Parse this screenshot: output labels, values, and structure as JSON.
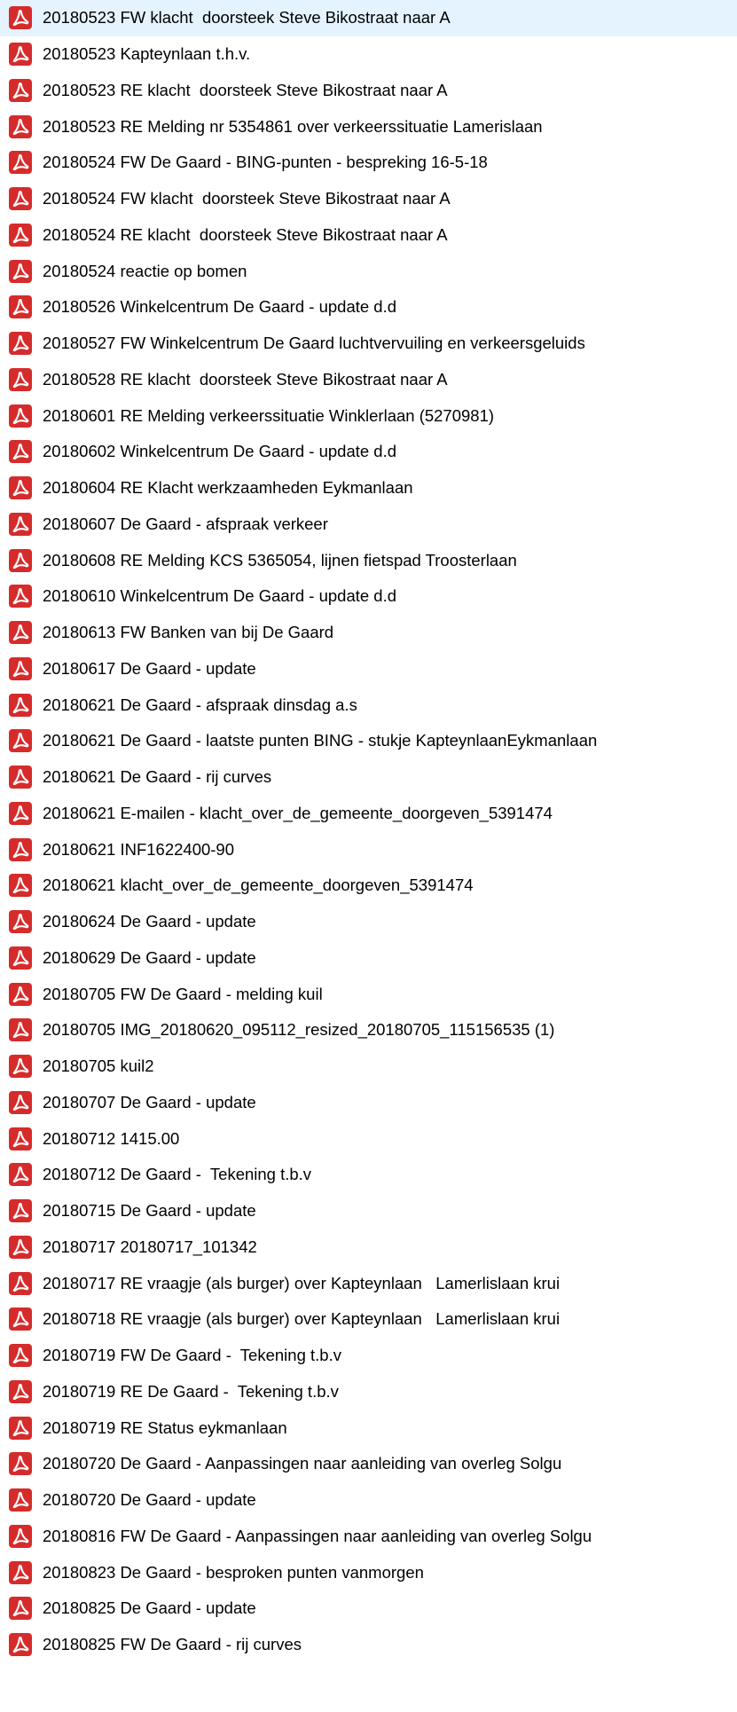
{
  "file_icon": "pdf-file-icon",
  "colors": {
    "icon_red": "#d62b2b",
    "text": "#000000",
    "background": "#ffffff"
  },
  "files": [
    {
      "name": "20180523 FW klacht  doorsteek Steve Bikostraat naar A"
    },
    {
      "name": "20180523 Kapteynlaan t.h.v."
    },
    {
      "name": "20180523 RE klacht  doorsteek Steve Bikostraat naar A"
    },
    {
      "name": "20180523 RE Melding nr 5354861 over verkeerssituatie Lamerislaan"
    },
    {
      "name": "20180524 FW De Gaard - BING-punten - bespreking 16-5-18"
    },
    {
      "name": "20180524 FW klacht  doorsteek Steve Bikostraat naar A"
    },
    {
      "name": "20180524 RE klacht  doorsteek Steve Bikostraat naar A"
    },
    {
      "name": "20180524 reactie op bomen"
    },
    {
      "name": "20180526 Winkelcentrum De Gaard - update d.d"
    },
    {
      "name": "20180527 FW Winkelcentrum De Gaard luchtvervuiling en verkeersgeluids"
    },
    {
      "name": "20180528 RE klacht  doorsteek Steve Bikostraat naar A"
    },
    {
      "name": "20180601 RE Melding verkeerssituatie Winklerlaan (5270981)"
    },
    {
      "name": "20180602 Winkelcentrum De Gaard - update d.d"
    },
    {
      "name": "20180604 RE Klacht werkzaamheden Eykmanlaan"
    },
    {
      "name": "20180607 De Gaard - afspraak verkeer"
    },
    {
      "name": "20180608 RE Melding KCS 5365054, lijnen fietspad Troosterlaan"
    },
    {
      "name": "20180610 Winkelcentrum De Gaard - update d.d"
    },
    {
      "name": "20180613 FW Banken van bij De Gaard"
    },
    {
      "name": "20180617 De Gaard - update"
    },
    {
      "name": "20180621 De Gaard - afspraak dinsdag a.s"
    },
    {
      "name": "20180621 De Gaard - laatste punten BING - stukje KapteynlaanEykmanlaan"
    },
    {
      "name": "20180621 De Gaard - rij curves"
    },
    {
      "name": "20180621 E-mailen - klacht_over_de_gemeente_doorgeven_5391474"
    },
    {
      "name": "20180621 INF1622400-90"
    },
    {
      "name": "20180621 klacht_over_de_gemeente_doorgeven_5391474"
    },
    {
      "name": "20180624 De Gaard - update"
    },
    {
      "name": "20180629 De Gaard - update"
    },
    {
      "name": "20180705 FW De Gaard - melding kuil"
    },
    {
      "name": "20180705 IMG_20180620_095112_resized_20180705_115156535 (1)"
    },
    {
      "name": "20180705 kuil2"
    },
    {
      "name": "20180707 De Gaard - update"
    },
    {
      "name": "20180712 1415.00"
    },
    {
      "name": "20180712 De Gaard -  Tekening t.b.v"
    },
    {
      "name": "20180715 De Gaard - update"
    },
    {
      "name": "20180717 20180717_101342"
    },
    {
      "name": "20180717 RE vraagje (als burger) over Kapteynlaan   Lamerlislaan krui"
    },
    {
      "name": "20180718 RE vraagje (als burger) over Kapteynlaan   Lamerlislaan krui"
    },
    {
      "name": "20180719 FW De Gaard -  Tekening t.b.v"
    },
    {
      "name": "20180719 RE De Gaard -  Tekening t.b.v"
    },
    {
      "name": "20180719 RE Status eykmanlaan"
    },
    {
      "name": "20180720 De Gaard - Aanpassingen naar aanleiding van overleg Solgu"
    },
    {
      "name": "20180720 De Gaard - update"
    },
    {
      "name": "20180816 FW De Gaard - Aanpassingen naar aanleiding van overleg Solgu"
    },
    {
      "name": "20180823 De Gaard - besproken punten vanmorgen"
    },
    {
      "name": "20180825 De Gaard - update"
    },
    {
      "name": "20180825 FW De Gaard - rij curves"
    }
  ]
}
